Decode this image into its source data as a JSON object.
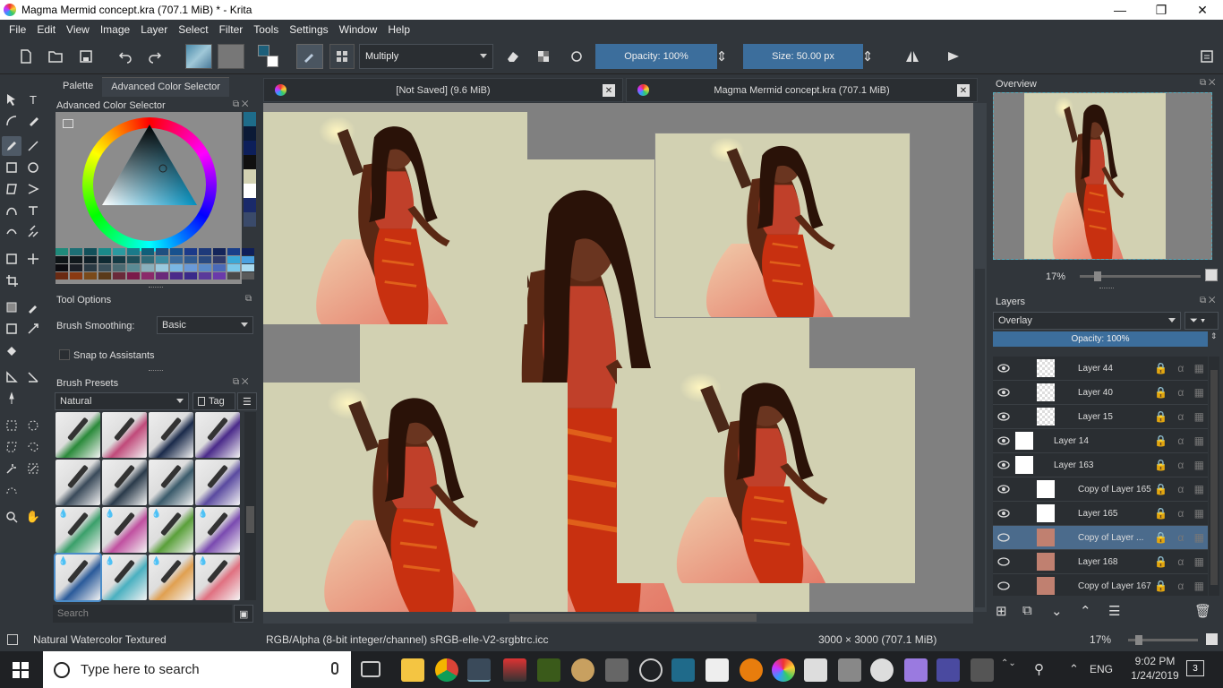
{
  "window": {
    "title": "Magma Mermid concept.kra (707.1 MiB) * - Krita",
    "minimize": "—",
    "maximize": "❐",
    "close": "✕"
  },
  "menu": [
    "File",
    "Edit",
    "View",
    "Image",
    "Layer",
    "Select",
    "Filter",
    "Tools",
    "Settings",
    "Window",
    "Help"
  ],
  "toolbar": {
    "blend_mode": "Multiply",
    "opacity_label": "Opacity:",
    "opacity_value": "100%",
    "size_label": "Size:",
    "size_value": "50.00 px",
    "fg_color": "#1d5f7a",
    "bg_color": "#ffffff"
  },
  "left_dock": {
    "tabs": [
      "Palette",
      "Advanced Color Selector"
    ],
    "active_tab": "Advanced Color Selector",
    "color_selector_title": "Advanced Color Selector",
    "tool_options_title": "Tool Options",
    "brush_smoothing_label": "Brush Smoothing:",
    "brush_smoothing_value": "Basic",
    "snap_label": "Snap to Assistants",
    "brush_presets_title": "Brush Presets",
    "preset_tag": "Natural",
    "tag_button": "Tag",
    "search_placeholder": "Search",
    "recent_colors": [
      "#1e6c8a",
      "#0b1a36",
      "#0d1f5a",
      "#101010",
      "#d2d1b2",
      "#ffffff",
      "#1a2a6a",
      "#3a4a6a"
    ],
    "swatches": [
      "#1f8a7a",
      "#1d6f75",
      "#12505a",
      "#1a8a8a",
      "#2a9aa0",
      "#1a7a8a",
      "#0f5f7a",
      "#1f4f80",
      "#17518e",
      "#1b3a8a",
      "#1e3a7a",
      "#14255a",
      "#1a3f8a",
      "#0f1f5a",
      "#0e1416",
      "#10181c",
      "#102028",
      "#0f2a33",
      "#143a44",
      "#1f4f5a",
      "#2f6a78",
      "#3a8aa0",
      "#3a6a9c",
      "#2f5a90",
      "#2a4a80",
      "#2f3a6a",
      "#3aa8d8",
      "#4aa0e0",
      "#0c0c10",
      "#1b1f26",
      "#2a3a44",
      "#3a4f5a",
      "#4a6a72",
      "#5a8a94",
      "#8ab0bc",
      "#9acadf",
      "#7ab6e4",
      "#6a9ad8",
      "#5a8ac8",
      "#4a6ab8",
      "#7ac8ea",
      "#aadaf0",
      "#6a2a12",
      "#8a3a12",
      "#7a4a1a",
      "#5a3a1a",
      "#6a2a3a",
      "#7a1a4a",
      "#8a2a6a",
      "#6a2a7a",
      "#4a2a8a",
      "#3a2a8a",
      "#5a3a9a",
      "#6a3aaa",
      "#4a4a4a",
      "#5a5a5a"
    ],
    "brushes": [
      {
        "color": "#2a8a3a",
        "wet": false
      },
      {
        "color": "#c04a7a",
        "wet": false
      },
      {
        "color": "#1a2a4a",
        "wet": false
      },
      {
        "color": "#4a2a8a",
        "wet": false
      },
      {
        "color": "#3a4a5a",
        "wet": false
      },
      {
        "color": "#2a3a4a",
        "wet": false
      },
      {
        "color": "#3a5a6a",
        "wet": false
      },
      {
        "color": "#5a4aa0",
        "wet": false
      },
      {
        "color": "#3aa06a",
        "wet": true
      },
      {
        "color": "#c050a0",
        "wet": true
      },
      {
        "color": "#5aa03a",
        "wet": true
      },
      {
        "color": "#7a4ab0",
        "wet": true
      },
      {
        "color": "#2a5a9a",
        "wet": true
      },
      {
        "color": "#4ab0c0",
        "wet": true
      },
      {
        "color": "#e0a050",
        "wet": true
      },
      {
        "color": "#e07080",
        "wet": true
      }
    ]
  },
  "documents": [
    {
      "title": "[Not Saved]  (9.6 MiB)"
    },
    {
      "title": "Magma Mermid concept.kra (707.1 MiB)"
    }
  ],
  "overview": {
    "title": "Overview",
    "zoom": "17%"
  },
  "layers": {
    "title": "Layers",
    "blend_mode": "Overlay",
    "opacity_label": "Opacity:",
    "opacity_value": "100%",
    "items": [
      {
        "name": "Layer 44",
        "indent": true,
        "selected": false
      },
      {
        "name": "Layer 40",
        "indent": true,
        "selected": false
      },
      {
        "name": "Layer 15",
        "indent": true,
        "selected": false
      },
      {
        "name": "Layer 14",
        "indent": false,
        "selected": false
      },
      {
        "name": "Layer 163",
        "indent": false,
        "selected": false
      },
      {
        "name": "Copy of Layer 165",
        "indent": true,
        "selected": false
      },
      {
        "name": "Layer 165",
        "indent": true,
        "selected": false
      },
      {
        "name": "Copy of Layer ...",
        "indent": true,
        "selected": true
      },
      {
        "name": "Layer 168",
        "indent": true,
        "selected": false
      },
      {
        "name": "Copy of Layer 167",
        "indent": true,
        "selected": false
      }
    ]
  },
  "status": {
    "brush": "Natural Watercolor Textured",
    "color_model": "RGB/Alpha (8-bit integer/channel)  sRGB-elle-V2-srgbtrc.icc",
    "dimensions": "3000 × 3000 (707.1 MiB)",
    "zoom": "17%"
  },
  "taskbar": {
    "search_placeholder": "Type here to search",
    "lang": "ENG",
    "time": "9:02 PM",
    "date": "1/24/2019",
    "notifications": "3"
  }
}
